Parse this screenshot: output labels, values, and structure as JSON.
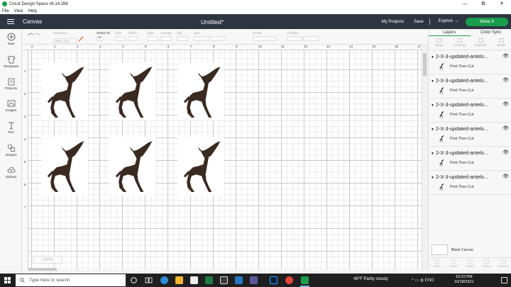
{
  "app": {
    "title": "Cricut Design Space  v6.14.288"
  },
  "window_controls": {
    "minimize": "—",
    "maximize": "⧉",
    "close": "✕"
  },
  "menu": [
    "File",
    "View",
    "Help"
  ],
  "header": {
    "section": "Canvas",
    "document_title": "Untitled*",
    "my_projects": "My Projects",
    "save": "Save",
    "explore": "Explore",
    "explore_caret": "⌵",
    "make_it": "Make It"
  },
  "toolbar": {
    "operation_label": "Operation",
    "operation_value": "Basic Cut",
    "select_all": "Select All",
    "edit": "Edit",
    "offset": "Offset",
    "align": "Align",
    "arrange": "Arrange",
    "flip": "Flip",
    "size": "Size",
    "rotate": "Rotate",
    "position": "Position"
  },
  "left_nav": [
    {
      "label": "New",
      "icon": "plus-circle-icon"
    },
    {
      "label": "Templates",
      "icon": "tshirt-icon"
    },
    {
      "label": "Projects",
      "icon": "projects-icon"
    },
    {
      "label": "Images",
      "icon": "image-icon"
    },
    {
      "label": "Text",
      "icon": "text-icon"
    },
    {
      "label": "Shapes",
      "icon": "shapes-icon"
    },
    {
      "label": "Upload",
      "icon": "cloud-upload-icon"
    }
  ],
  "ruler": {
    "top": [
      "0",
      "1",
      "2",
      "3",
      "4",
      "5",
      "6",
      "7",
      "8",
      "9",
      "10",
      "11",
      "12",
      "13",
      "14",
      "15",
      "16",
      "17"
    ],
    "left": [
      "1",
      "2",
      "3",
      "4",
      "5",
      "6",
      "7"
    ]
  },
  "zoom": "100%",
  "right_panel": {
    "tabs": [
      "Layers",
      "Color Sync"
    ],
    "actions": [
      "Group",
      "UnGroup",
      "Duplicate",
      "Delete"
    ],
    "layers": [
      {
        "name": "2-X-3-updated-antelo...",
        "sub": "Print Then Cut"
      },
      {
        "name": "2-X-3-updated-antelo...",
        "sub": "Print Then Cut"
      },
      {
        "name": "2-X-3-updated-antelo...",
        "sub": "Print Then Cut"
      },
      {
        "name": "2-X-3-updated-antelo...",
        "sub": "Print Then Cut"
      },
      {
        "name": "2-X-3-updated-antelo...",
        "sub": "Print Then Cut"
      },
      {
        "name": "2-X-3-updated-antelo...",
        "sub": "Print Then Cut"
      }
    ],
    "blank_canvas": "Blank Canvas",
    "bottom_actions": [
      "Slice",
      "Weld",
      "Attach",
      "Flatten",
      "Contour"
    ]
  },
  "taskbar": {
    "search_placeholder": "Type here to search",
    "weather": "49°F  Partly cloudy",
    "tray": "^  ▭  ◍  ENG",
    "time": "10:22 PM",
    "date": "10/18/2021"
  }
}
